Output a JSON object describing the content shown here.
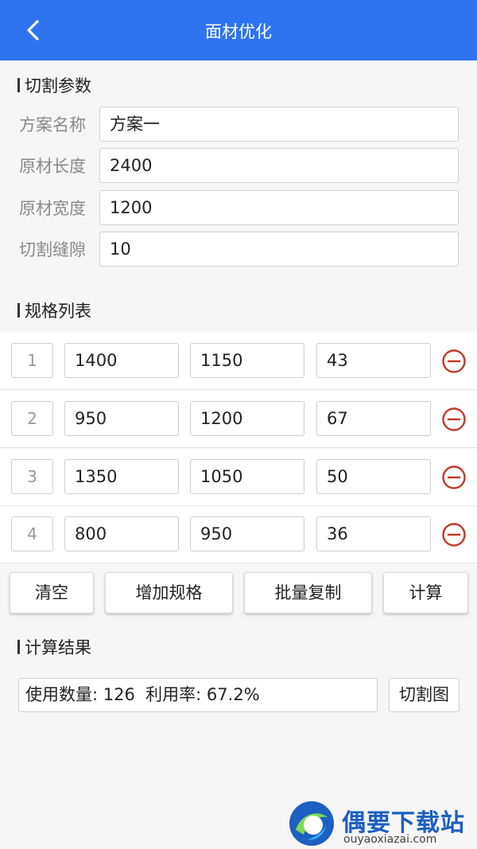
{
  "header": {
    "title": "面材优化"
  },
  "params": {
    "section_title": "切割参数",
    "rows": [
      {
        "label": "方案名称",
        "value": "方案一"
      },
      {
        "label": "原材长度",
        "value": "2400"
      },
      {
        "label": "原材宽度",
        "value": "1200"
      },
      {
        "label": "切割缝隙",
        "value": "10"
      }
    ]
  },
  "specs": {
    "section_title": "规格列表",
    "rows": [
      {
        "index": "1",
        "length": "1400",
        "width": "1150",
        "count": "43"
      },
      {
        "index": "2",
        "length": "950",
        "width": "1200",
        "count": "67"
      },
      {
        "index": "3",
        "length": "1350",
        "width": "1050",
        "count": "50"
      },
      {
        "index": "4",
        "length": "800",
        "width": "950",
        "count": "36"
      }
    ]
  },
  "actions": {
    "clear": "清空",
    "add_spec": "增加规格",
    "batch_copy": "批量复制",
    "calculate": "计算"
  },
  "result": {
    "section_title": "计算结果",
    "text": "使用数量: 126  利用率: 67.2%",
    "cut_chart_button": "切割图"
  },
  "watermark": {
    "title": "偶要下载站",
    "url": "ouyaoxiazai.com"
  },
  "colors": {
    "header_bg": "#2f73f0",
    "delete_icon": "#c0392b"
  }
}
